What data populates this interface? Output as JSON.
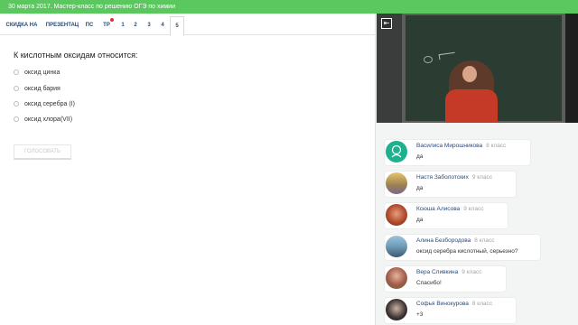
{
  "topbar": {
    "title": "30 марта 2017. Мастер-класс по решению ОГЭ по химии"
  },
  "tabs": [
    {
      "label": "СКИДКА НА"
    },
    {
      "label": "ПРЕЗЕНТАЦ"
    },
    {
      "label": "ПС"
    },
    {
      "label": "ТР"
    },
    {
      "label": "1"
    },
    {
      "label": "2"
    },
    {
      "label": "3"
    },
    {
      "label": "4"
    },
    {
      "label": "5"
    }
  ],
  "quiz": {
    "question": "К кислотным оксидам относится:",
    "options": [
      "оксид цинка",
      "оксид бария",
      "оксид серебра (I)",
      "оксид хлора(VII)"
    ],
    "vote_label": "ГОЛОСОВАТЬ"
  },
  "video": {
    "back_icon": "back-icon"
  },
  "chat": [
    {
      "name": "Василиса Мирошникова",
      "grade": "8 класс",
      "text": "да",
      "avatar_color": "#1fb08e"
    },
    {
      "name": "Настя Заболотских",
      "grade": "9 класс",
      "text": "да",
      "avatar_color": "#c9a24a"
    },
    {
      "name": "Ксюша Алисова",
      "grade": "9 класс",
      "text": "да",
      "avatar_color": "#b34a2e"
    },
    {
      "name": "Алина Безбородова",
      "grade": "8 класс",
      "text": "оксид серебра кислотный, серьезно?",
      "avatar_color": "#6e9ab8"
    },
    {
      "name": "Вера Сливкина",
      "grade": "9 класс",
      "text": "Спасибо!",
      "avatar_color": "#a15a4a"
    },
    {
      "name": "Софья Винокурова",
      "grade": "8 класс",
      "text": "+3",
      "avatar_color": "#3a3030"
    }
  ],
  "colors": {
    "topbar": "#5bc85f",
    "link": "#2a4a7a",
    "notification_dot": "#e0312b"
  }
}
